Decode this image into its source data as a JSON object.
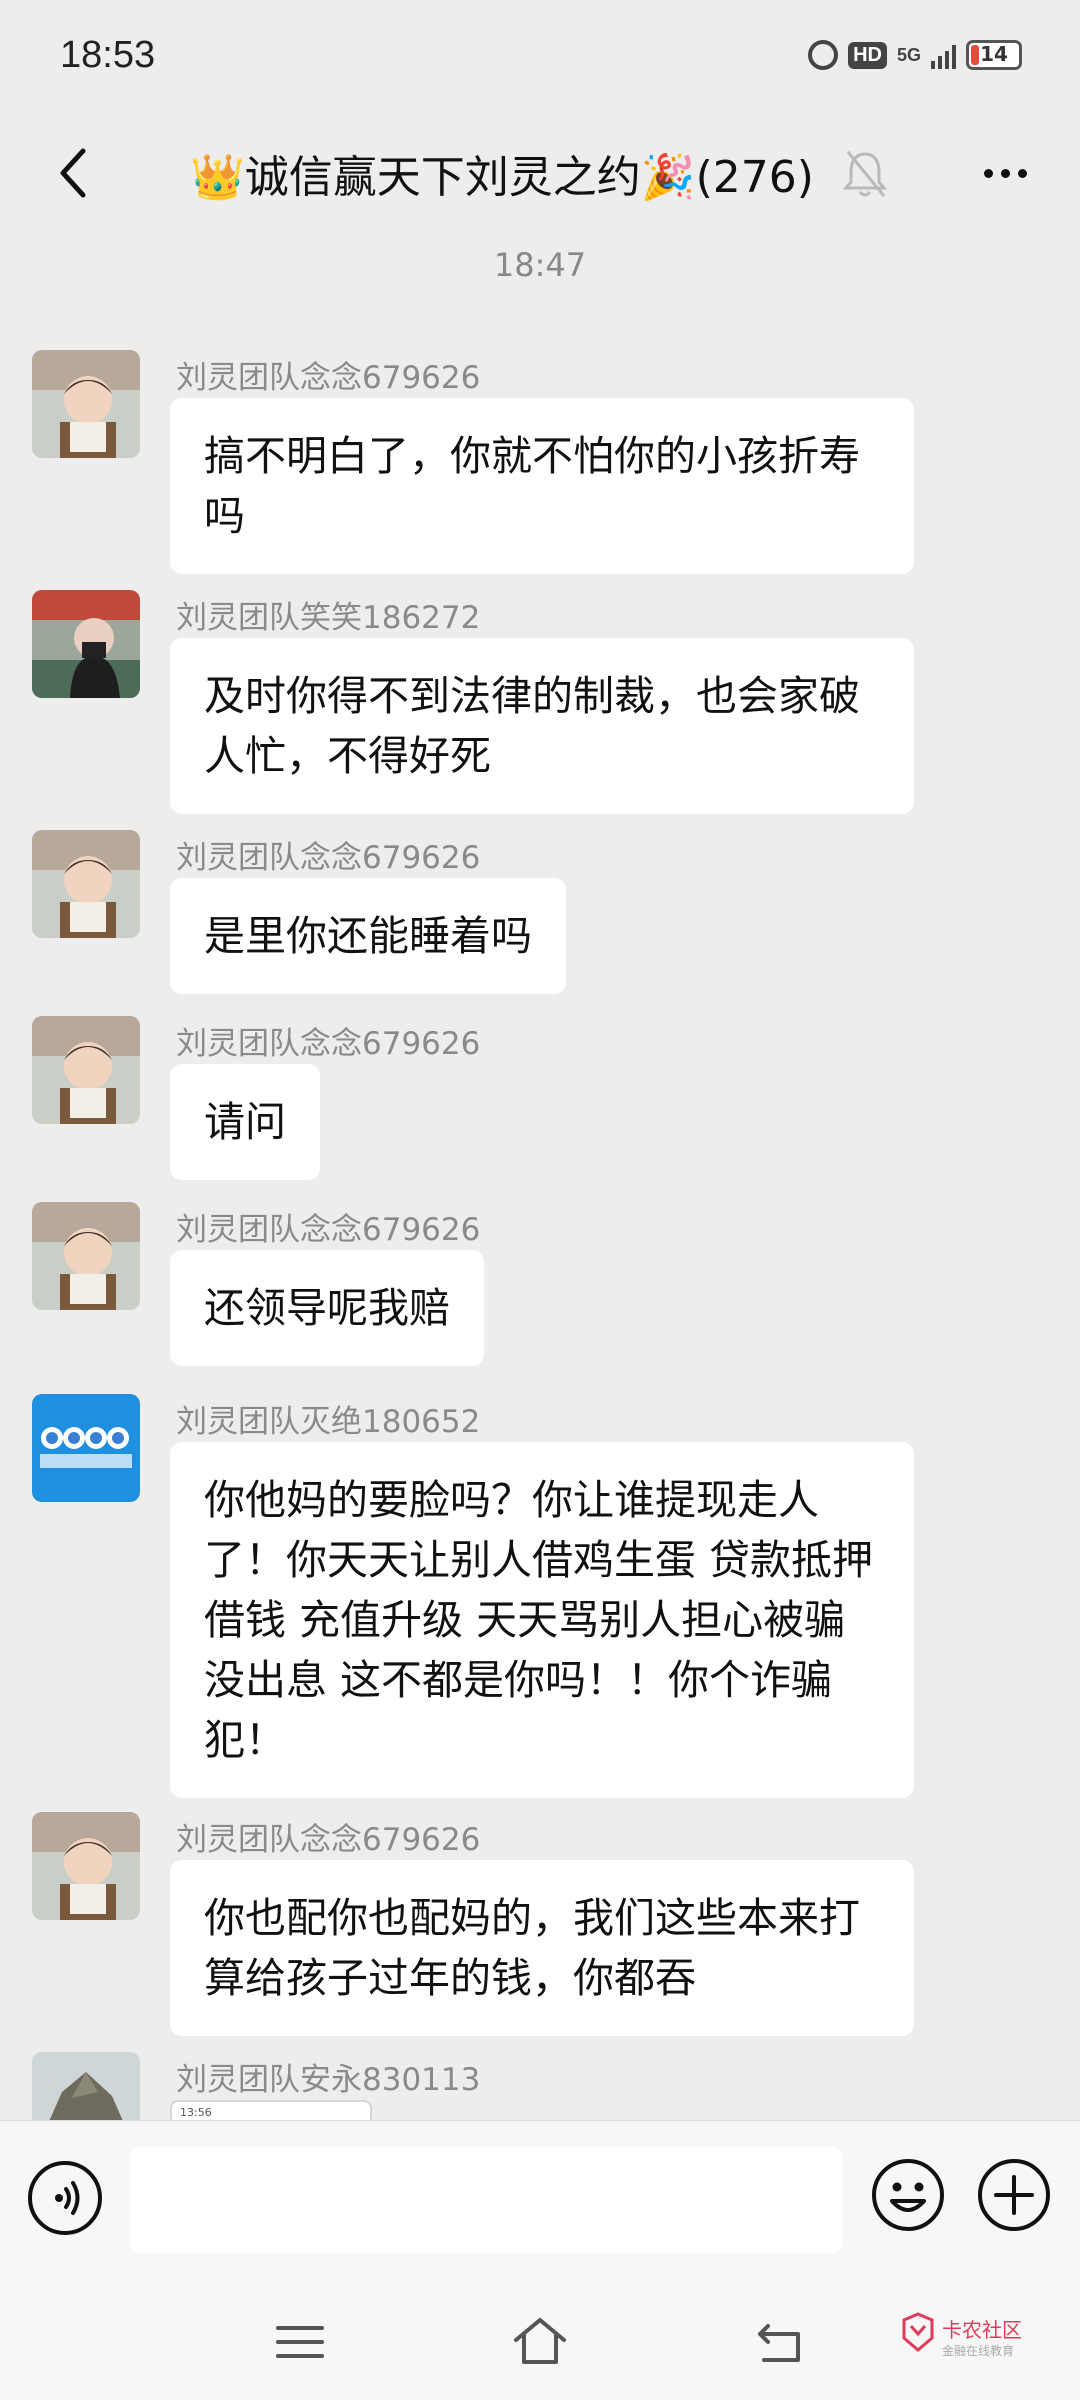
{
  "status_bar": {
    "time": "18:53",
    "hd": "HD",
    "network": "5G",
    "battery": "14"
  },
  "header": {
    "title": "👑诚信赢天下刘灵之约🎉(276)"
  },
  "chat": {
    "time_separator": "18:47",
    "messages": [
      {
        "sender": "刘灵团队念念679626",
        "text": "搞不明白了，你就不怕你的小孩折寿吗"
      },
      {
        "sender": "刘灵团队笑笑186272",
        "text": "及时你得不到法律的制裁，也会家破人忙，不得好死"
      },
      {
        "sender": "刘灵团队念念679626",
        "text": "是里你还能睡着吗"
      },
      {
        "sender": "刘灵团队念念679626",
        "text": "请问"
      },
      {
        "sender": "刘灵团队念念679626",
        "text": "还领导呢我赔"
      },
      {
        "sender": "刘灵团队灭绝180652",
        "text": "你他妈的要脸吗？你让谁提现走人了！你天天让别人借鸡生蛋 贷款抵押借钱 充值升级 天天骂别人担心被骗没出息 这不都是你吗！！你个诈骗犯！"
      },
      {
        "sender": "刘灵团队念念679626",
        "text": "你也配你也配妈的，我们这些本来打算给孩子过年的钱，你都吞"
      },
      {
        "sender": "刘灵团队安永830113",
        "screenshot_time": "13:56"
      }
    ]
  },
  "input_bar": {
    "placeholder": ""
  },
  "watermark": {
    "brand": "卡农社区",
    "sub": "金融在线教育"
  },
  "colors": {
    "background": "#ededed",
    "bubble": "#ffffff",
    "sender": "#8a8a8a",
    "watermark": "#e03b5b"
  }
}
